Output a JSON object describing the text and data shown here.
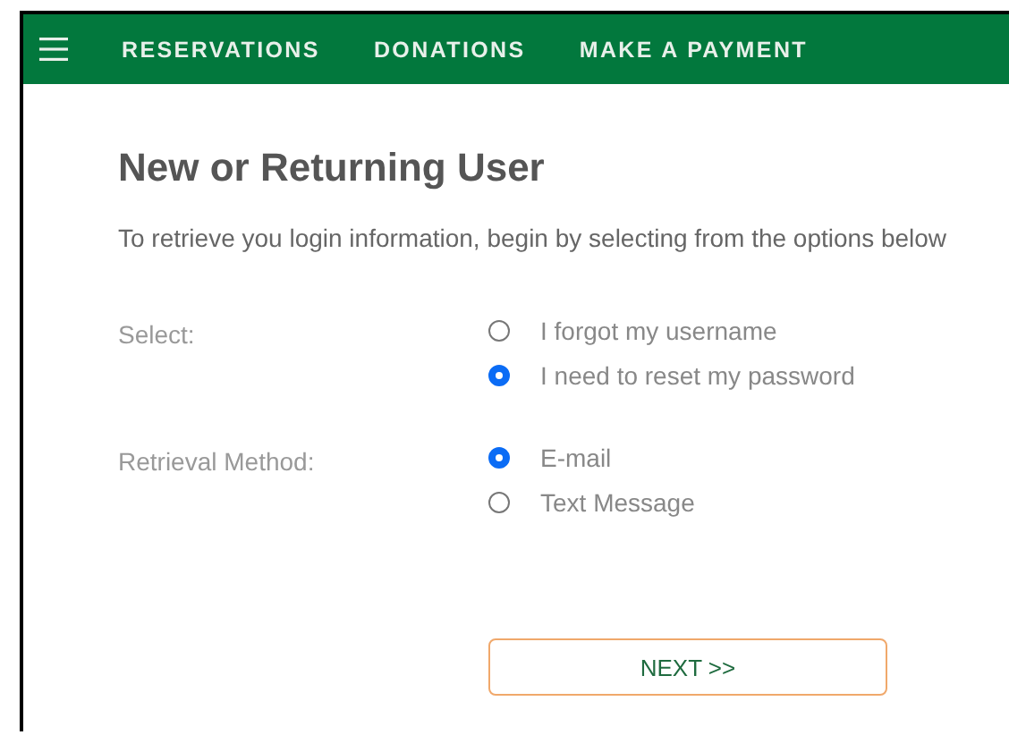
{
  "nav": {
    "items": [
      {
        "label": "RESERVATIONS"
      },
      {
        "label": "DONATIONS"
      },
      {
        "label": "MAKE A PAYMENT"
      }
    ]
  },
  "heading": "New or Returning User",
  "intro": "To retrieve you login information, begin by selecting from the options below",
  "groups": [
    {
      "label": "Select:",
      "options": [
        {
          "label": "I forgot my username",
          "selected": false
        },
        {
          "label": "I need to reset my password",
          "selected": true
        }
      ]
    },
    {
      "label": "Retrieval Method:",
      "options": [
        {
          "label": "E-mail",
          "selected": true
        },
        {
          "label": "Text Message",
          "selected": false
        }
      ]
    }
  ],
  "next_button": "NEXT >>"
}
